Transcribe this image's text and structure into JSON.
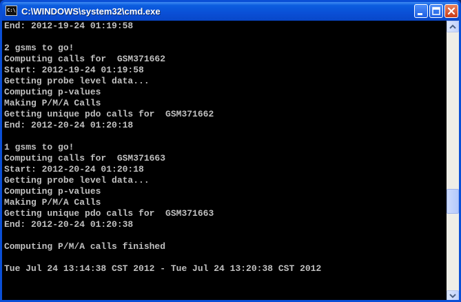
{
  "window": {
    "title": "C:\\WINDOWS\\system32\\cmd.exe",
    "icon": "console-icon",
    "icon_text": "C:\\"
  },
  "console": {
    "lines": [
      "End: 2012-19-24 01:19:58",
      "",
      "2 gsms to go!",
      "Computing calls for  GSM371662",
      "Start: 2012-19-24 01:19:58",
      "Getting probe level data...",
      "Computing p-values",
      "Making P/M/A Calls",
      "Getting unique pdo calls for  GSM371662",
      "End: 2012-20-24 01:20:18",
      "",
      "1 gsms to go!",
      "Computing calls for  GSM371663",
      "Start: 2012-20-24 01:20:18",
      "Getting probe level data...",
      "Computing p-values",
      "Making P/M/A Calls",
      "Getting unique pdo calls for  GSM371663",
      "End: 2012-20-24 01:20:38",
      "",
      "Computing P/M/A calls finished",
      "",
      "Tue Jul 24 13:14:38 CST 2012 - Tue Jul 24 13:20:38 CST 2012"
    ],
    "text_color": "#c0c0c0",
    "background_color": "#000000"
  },
  "scrollbar": {
    "position_fraction": 0.62
  },
  "colors": {
    "titlebar": "#0a4fd6",
    "close_button": "#c73b17"
  }
}
